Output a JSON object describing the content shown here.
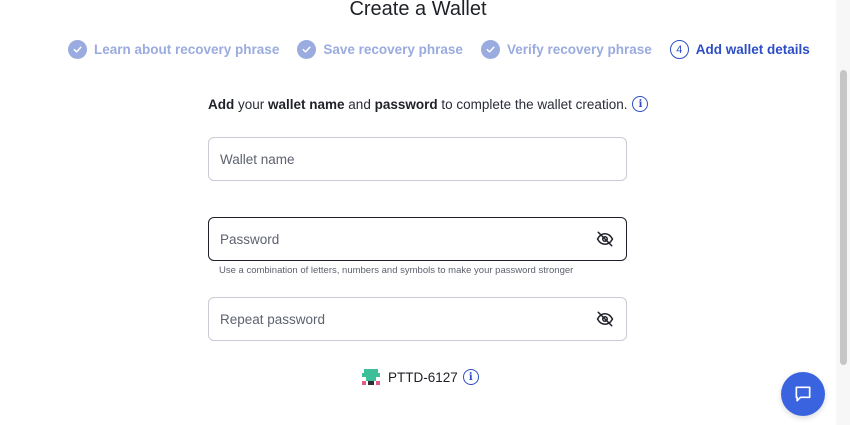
{
  "header": {
    "title": "Create a Wallet"
  },
  "steps": [
    {
      "label": "Learn about recovery phrase",
      "state": "done"
    },
    {
      "label": "Save recovery phrase",
      "state": "done"
    },
    {
      "label": "Verify recovery phrase",
      "state": "done"
    },
    {
      "label": "Add wallet details",
      "state": "active",
      "number": "4"
    }
  ],
  "intro": {
    "part1": "Add",
    "part2": " your ",
    "part3": "wallet name",
    "part4": " and ",
    "part5": "password",
    "part6": " to complete the wallet creation."
  },
  "form": {
    "wallet_name": {
      "placeholder": "Wallet name",
      "value": ""
    },
    "password": {
      "placeholder": "Password",
      "value": ""
    },
    "password_hint": "Use a combination of letters, numbers and symbols to make your password stronger",
    "repeat_password": {
      "placeholder": "Repeat password",
      "value": ""
    }
  },
  "wallet_checksum": {
    "label": "PTTD-6127"
  },
  "icons": {
    "info": "info-icon",
    "eye_off": "eye-off-icon",
    "chat": "chat-icon",
    "check": "check-icon"
  },
  "colors": {
    "accent": "#2d4ec4",
    "step_done": "#9aabdf",
    "fab": "#3a63e0"
  }
}
